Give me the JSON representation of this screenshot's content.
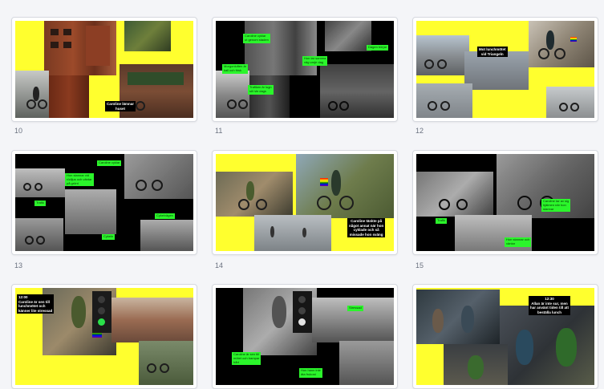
{
  "slides": [
    {
      "number": "10",
      "caption": "Caroline lämnar\nhuset"
    },
    {
      "number": "11",
      "tags": [
        "Caroline cyklar\nut genom staden",
        "Morgonluften är\nkall och frisk",
        "Hon tar samma\nväg varje dag",
        "Trafiken är lugn\nså här dags",
        "Dagen börjar"
      ]
    },
    {
      "number": "12",
      "caption": "Mot lunchmötet\nvid Triangeln"
    },
    {
      "number": "13",
      "tags": [
        "Caroline cyklar",
        "Hon stannar vid\nrödljus och väntar\npå grönt",
        "Trafik",
        "Cykelvägen",
        "Cykeln"
      ]
    },
    {
      "number": "14",
      "caption": "Caroline tänkte på\nnågot annat när hon\ncyklade och så\nmissade hon sväng"
    },
    {
      "number": "15",
      "tags": [
        "Caroline tar av sig\nhjälmen när hon\nstannar",
        "Trafik",
        "Hon stannar och\nväntar"
      ]
    },
    {
      "number": "",
      "caption": "12:00\nCaroline är sen till\nlunchmötet och\nkänner lite stressad"
    },
    {
      "number": "",
      "tags": [
        "Stressad",
        "Caroline är sen till\nmötet och trampar\nhårt",
        "Hon hann inte\näta frukost"
      ]
    },
    {
      "number": "",
      "caption": "12:30\nAllan är inte sur, men\nhar använt tiden till att\nbeställa lunch"
    }
  ]
}
